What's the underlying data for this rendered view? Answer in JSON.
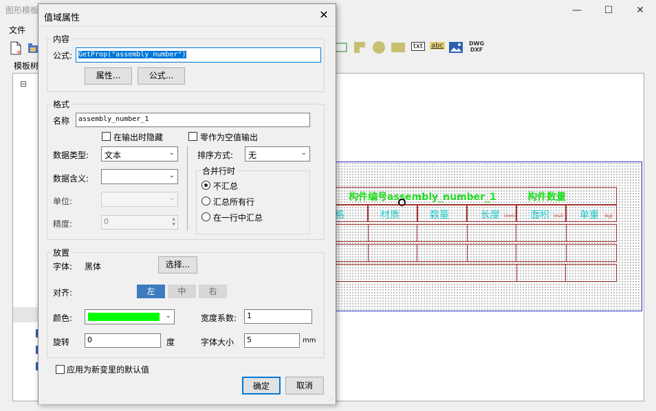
{
  "app": {
    "title": "图形模板",
    "menu": {
      "file": "文件"
    },
    "tree_title": "模板树",
    "tree_expand": "⊟",
    "toolbar": {
      "txt": "txt",
      "abc": "abc",
      "dwg": "DWG",
      "dxf": "DXF"
    },
    "controls": {
      "min": "—",
      "max": "☐",
      "close": "✕"
    }
  },
  "canvas": {
    "header_text": "构件编号assembly_number_1",
    "header_text2": "构件数量",
    "columns": [
      "格",
      "材质",
      "数量",
      "长度",
      "面积",
      "单重"
    ],
    "units": {
      "length": "(mm)",
      "area": "(m2)",
      "weight": "(kg)"
    },
    "colors": {
      "green": "#22dd22",
      "cyan": "#22cccc",
      "border": "#a03030"
    }
  },
  "dialog": {
    "title": "值域属性",
    "close": "✕",
    "content": {
      "label": "内容",
      "formula_label": "公式:",
      "formula_value": "GetProp(\"assembly_number\")",
      "attr_button": "属性...",
      "formula_button": "公式..."
    },
    "format": {
      "label": "格式",
      "name_label": "名称",
      "name_value": "assembly_number_1",
      "hide_on_output": "在输出时隐藏",
      "zero_as_empty": "零作为空值输出",
      "data_type_label": "数据类型:",
      "data_type_value": "文本",
      "data_meaning_label": "数据含义:",
      "data_meaning_value": "",
      "unit_label": "单位:",
      "unit_value": "",
      "precision_label": "精度:",
      "precision_value": "0",
      "sort_label": "排序方式:",
      "sort_value": "无",
      "merge_label": "合并行时",
      "merge_options": [
        "不汇总",
        "汇总所有行",
        "在一行中汇总"
      ]
    },
    "placement": {
      "label": "放置",
      "font_label": "字体:",
      "font_value": "黑体",
      "select_button": "选择...",
      "align_label": "对齐:",
      "align_left": "左",
      "align_center": "中",
      "align_right": "右",
      "color_label": "颜色:",
      "color_value": "#00ff00",
      "width_factor_label": "宽度系数:",
      "width_factor_value": "1",
      "rotation_label": "旋转",
      "rotation_value": "0",
      "rotation_unit": "度",
      "font_size_label": "字体大小",
      "font_size_value": "5",
      "font_size_unit": "mm"
    },
    "apply_default": "应用为新变里的默认值",
    "ok": "确定",
    "cancel": "取消"
  }
}
